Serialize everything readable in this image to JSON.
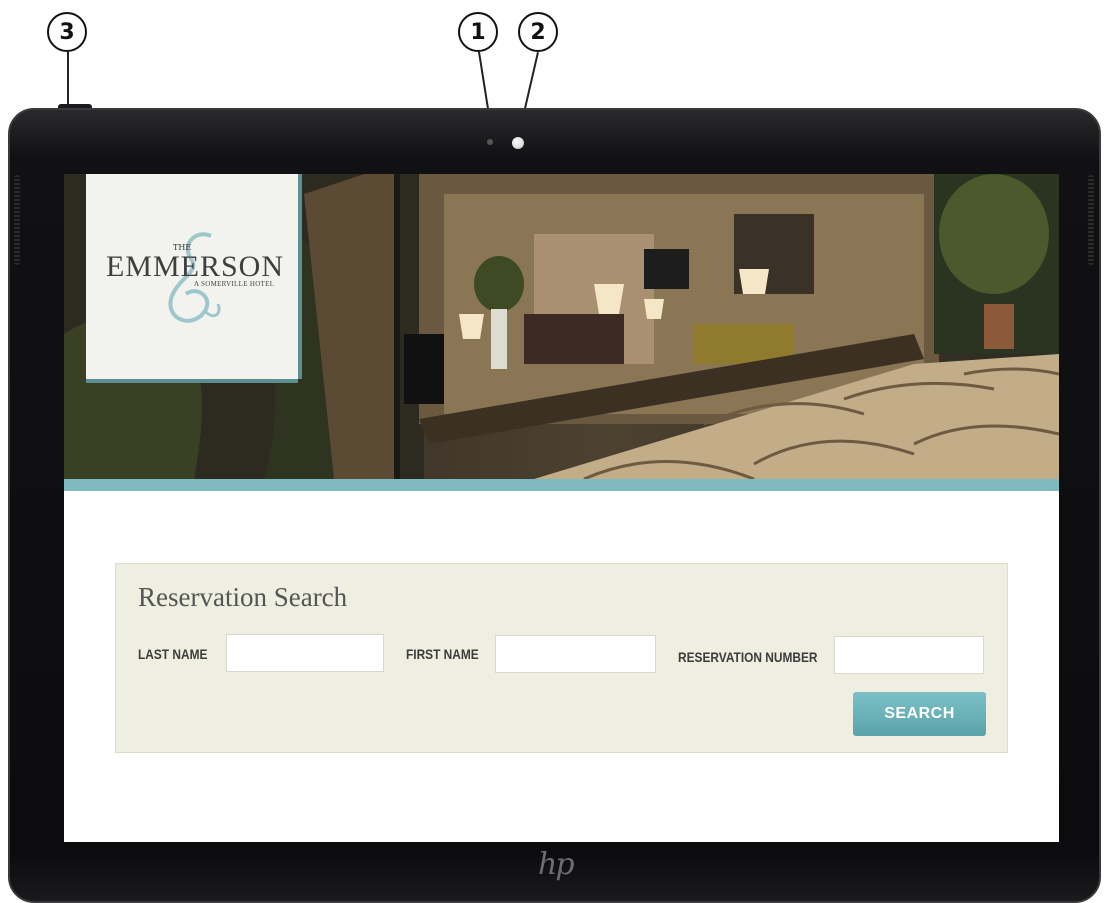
{
  "callouts": [
    "1",
    "2",
    "3"
  ],
  "logo": {
    "the": "THE",
    "name": "EMMERSON",
    "tagline": "A SOMERVILLE HOTEL"
  },
  "reservation": {
    "title": "Reservation Search",
    "last_name_label": "LAST NAME",
    "first_name_label": "FIRST NAME",
    "reservation_number_label": "RESERVATION NUMBER",
    "last_name_value": "",
    "first_name_value": "",
    "reservation_number_value": "",
    "search_label": "SEARCH"
  },
  "device": {
    "brand_logo": "hp"
  },
  "colors": {
    "accent": "#7fbac0",
    "button": "#5aa3aa",
    "panel": "#eeeee1"
  }
}
